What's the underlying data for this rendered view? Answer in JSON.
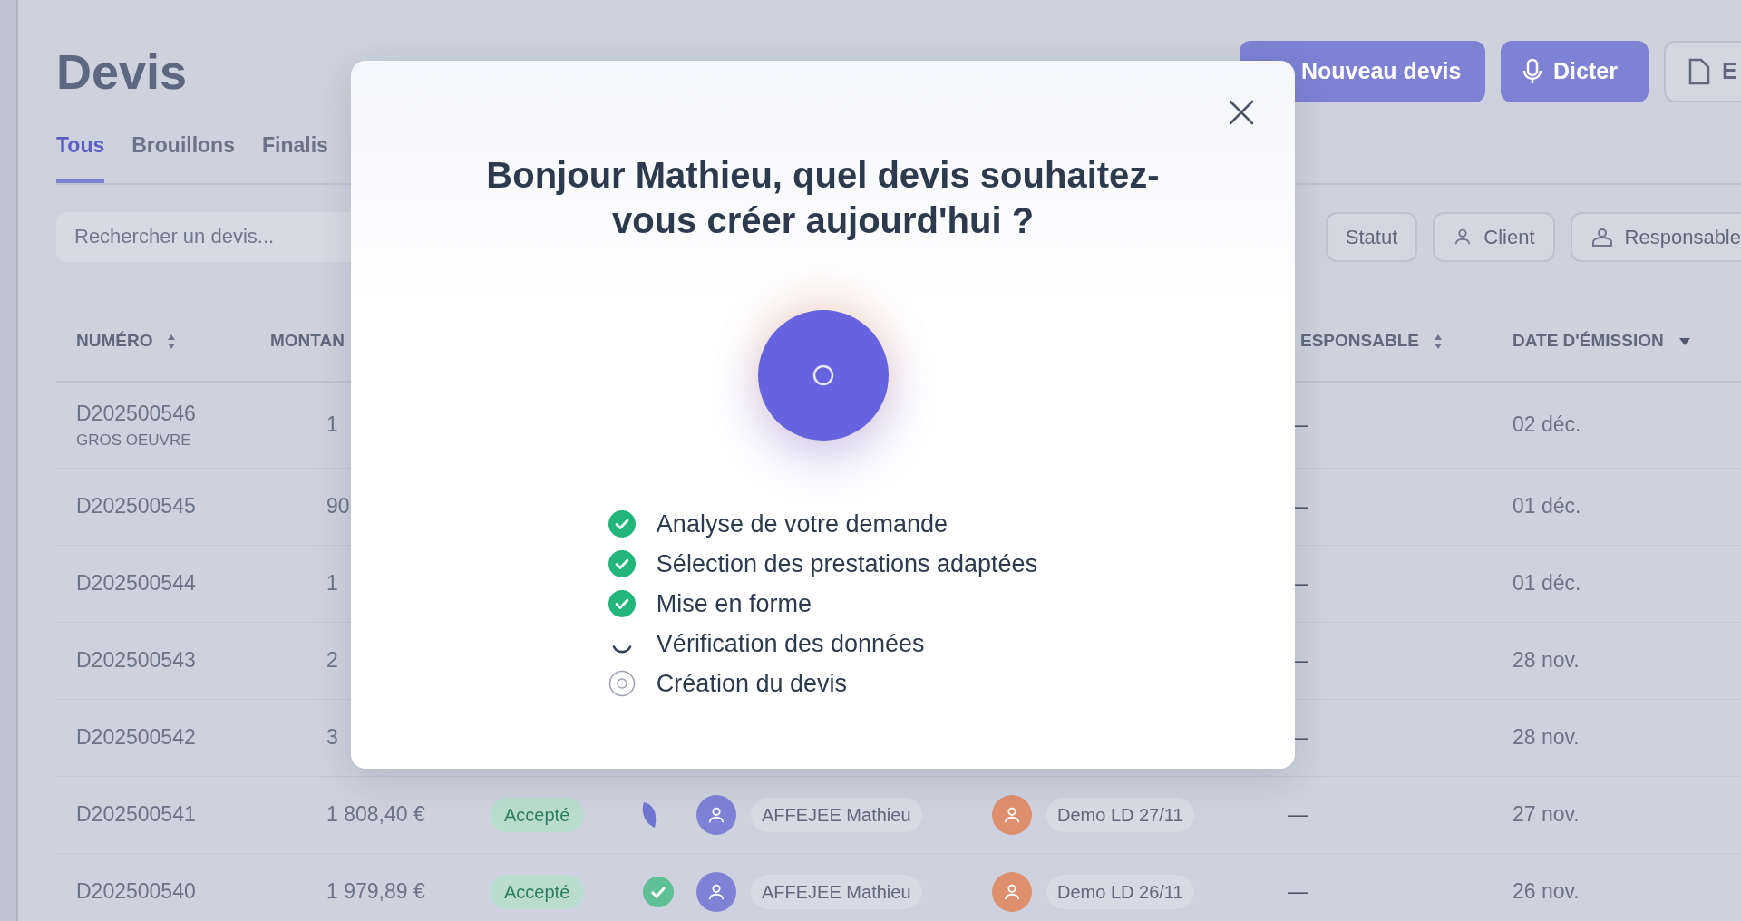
{
  "page": {
    "title": "Devis",
    "actions": [
      {
        "label": "Nouveau devis",
        "kind": "new"
      },
      {
        "label": "Dicter",
        "kind": "dictate"
      },
      {
        "label": "E",
        "kind": "export"
      }
    ],
    "tabs": [
      {
        "label": "Tous",
        "selected": true
      },
      {
        "label": "Brouillons",
        "selected": false
      },
      {
        "label": "Finalis",
        "selected": false
      }
    ],
    "search": {
      "placeholder": "Rechercher un devis..."
    },
    "filters": [
      {
        "label": "Statut",
        "kind": "status"
      },
      {
        "label": "Client",
        "kind": "client"
      },
      {
        "label": "Responsable",
        "kind": "owner"
      }
    ],
    "table": {
      "columns": [
        {
          "label": "NUMÉRO",
          "kind": "sortable"
        },
        {
          "label": "MONTAN",
          "kind": "plain"
        },
        {
          "label": "ESPONSABLE",
          "kind": "sortable"
        },
        {
          "label": "DATE D'ÉMISSION",
          "kind": "sorted"
        }
      ],
      "rows": [
        {
          "number": "D202500546",
          "subtitle": "GROS OEUVRE",
          "amount": "1",
          "owner": "—",
          "date": "02 déc."
        },
        {
          "number": "D202500545",
          "amount": "90",
          "owner": "—",
          "date": "01 déc."
        },
        {
          "number": "D202500544",
          "amount": "1",
          "owner": "—",
          "date": "01 déc."
        },
        {
          "number": "D202500543",
          "amount": "2",
          "owner": "—",
          "date": "28 nov."
        },
        {
          "number": "D202500542",
          "amount": "3",
          "owner": "—",
          "date": "28 nov."
        },
        {
          "number": "D202500541",
          "amount": "1 808,40 €",
          "status": "Accepté",
          "sign": {
            "kind": "feather"
          },
          "person": "AFFEJEE Mathieu",
          "client": "Demo LD 27/11",
          "owner": "—",
          "date": "27 nov."
        },
        {
          "number": "D202500540",
          "amount": "1 979,89 €",
          "status": "Accepté",
          "sign": {
            "kind": "check"
          },
          "person": "AFFEJEE Mathieu",
          "client": "Demo LD 26/11",
          "owner": "—",
          "date": "26 nov."
        }
      ]
    }
  },
  "modal": {
    "title": "Bonjour Mathieu, quel devis souhaitez-vous créer aujourd'hui ?",
    "steps": [
      {
        "label": "Analyse de votre demande",
        "kind": "done"
      },
      {
        "label": "Sélection des prestations adaptées",
        "kind": "done"
      },
      {
        "label": "Mise en forme",
        "kind": "done"
      },
      {
        "label": "Vérification des données",
        "kind": "active"
      },
      {
        "label": "Création du devis",
        "kind": "pending"
      }
    ]
  }
}
